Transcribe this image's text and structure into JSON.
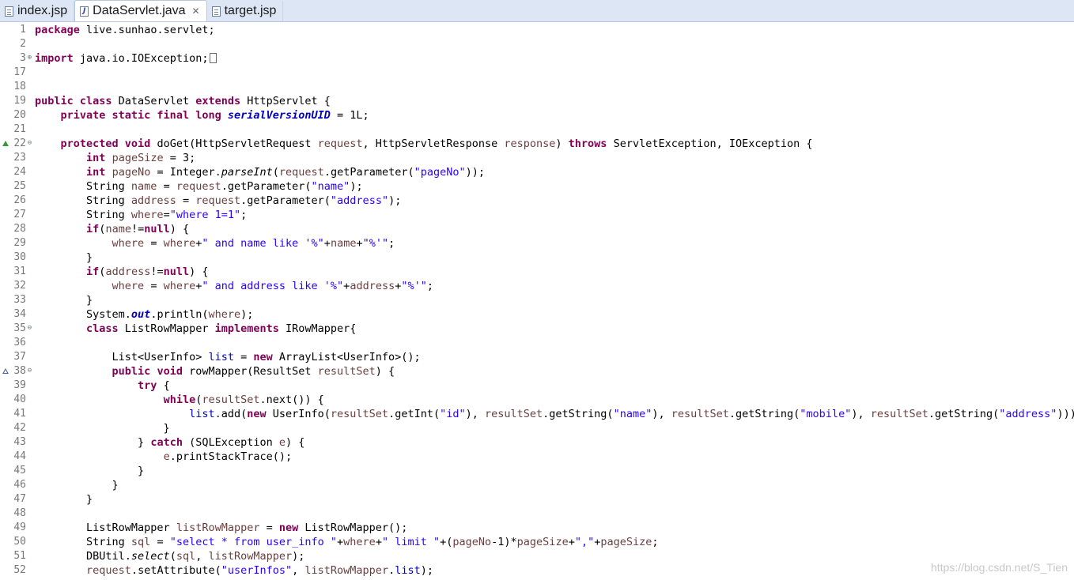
{
  "tabs": [
    {
      "label": "index.jsp",
      "icon": "jsp-file-icon",
      "active": false
    },
    {
      "label": "DataServlet.java",
      "icon": "java-file-icon",
      "active": true,
      "close": "✕"
    },
    {
      "label": "target.jsp",
      "icon": "jsp-file-icon",
      "active": false
    }
  ],
  "java_icon_glyph": "J",
  "lines": [
    {
      "n": "1",
      "tokens": [
        [
          "k",
          "package"
        ],
        [
          "",
          "live.sunhao.servlet;"
        ]
      ]
    },
    {
      "n": "2",
      "tokens": []
    },
    {
      "n": "3",
      "marker": "⊕",
      "fold_box": true,
      "tokens": [
        [
          "k",
          "import"
        ],
        [
          "",
          " java.io.IOException;"
        ]
      ]
    },
    {
      "n": "17",
      "tokens": []
    },
    {
      "n": "18",
      "tokens": []
    },
    {
      "n": "19",
      "tokens": [
        [
          "k",
          "public class"
        ],
        [
          "",
          " DataServlet "
        ],
        [
          "k",
          "extends"
        ],
        [
          "",
          " HttpServlet {"
        ]
      ]
    },
    {
      "n": "20",
      "tokens": [
        [
          "",
          "    "
        ],
        [
          "k",
          "private static final long"
        ],
        [
          "",
          " "
        ],
        [
          "sf",
          "serialVersionUID"
        ],
        [
          "",
          " = 1L;"
        ]
      ]
    },
    {
      "n": "21",
      "tokens": []
    },
    {
      "n": "22",
      "marker": "⊖",
      "override": "impl",
      "tokens": [
        [
          "",
          "    "
        ],
        [
          "k",
          "protected void"
        ],
        [
          "",
          " doGet(HttpServletRequest "
        ],
        [
          "v",
          "request"
        ],
        [
          "",
          ", HttpServletResponse "
        ],
        [
          "v",
          "response"
        ],
        [
          "",
          ") "
        ],
        [
          "k",
          "throws"
        ],
        [
          "",
          " ServletException, IOException {"
        ]
      ]
    },
    {
      "n": "23",
      "tokens": [
        [
          "",
          "        "
        ],
        [
          "k",
          "int"
        ],
        [
          "",
          " "
        ],
        [
          "v",
          "pageSize"
        ],
        [
          "",
          " = 3;"
        ]
      ]
    },
    {
      "n": "24",
      "tokens": [
        [
          "",
          "        "
        ],
        [
          "k",
          "int"
        ],
        [
          "",
          " "
        ],
        [
          "v",
          "pageNo"
        ],
        [
          "",
          " = Integer."
        ],
        [
          "it",
          "parseInt"
        ],
        [
          "",
          "("
        ],
        [
          "v",
          "request"
        ],
        [
          "",
          ".getParameter("
        ],
        [
          "s",
          "\"pageNo\""
        ],
        [
          "",
          "));"
        ]
      ]
    },
    {
      "n": "25",
      "tokens": [
        [
          "",
          "        String "
        ],
        [
          "v",
          "name"
        ],
        [
          "",
          " = "
        ],
        [
          "v",
          "request"
        ],
        [
          "",
          ".getParameter("
        ],
        [
          "s",
          "\"name\""
        ],
        [
          "",
          ");"
        ]
      ]
    },
    {
      "n": "26",
      "tokens": [
        [
          "",
          "        String "
        ],
        [
          "v",
          "address"
        ],
        [
          "",
          " = "
        ],
        [
          "v",
          "request"
        ],
        [
          "",
          ".getParameter("
        ],
        [
          "s",
          "\"address\""
        ],
        [
          "",
          ");"
        ]
      ]
    },
    {
      "n": "27",
      "tokens": [
        [
          "",
          "        String "
        ],
        [
          "v",
          "where"
        ],
        [
          "",
          "="
        ],
        [
          "s",
          "\"where 1=1\""
        ],
        [
          "",
          ";"
        ]
      ]
    },
    {
      "n": "28",
      "tokens": [
        [
          "",
          "        "
        ],
        [
          "k",
          "if"
        ],
        [
          "",
          "("
        ],
        [
          "v",
          "name"
        ],
        [
          "",
          "!="
        ],
        [
          "k",
          "null"
        ],
        [
          "",
          ") {"
        ]
      ]
    },
    {
      "n": "29",
      "tokens": [
        [
          "",
          "            "
        ],
        [
          "v",
          "where"
        ],
        [
          "",
          " = "
        ],
        [
          "v",
          "where"
        ],
        [
          "",
          "+"
        ],
        [
          "s",
          "\" and name like '%\""
        ],
        [
          "",
          "+"
        ],
        [
          "v",
          "name"
        ],
        [
          "",
          "+"
        ],
        [
          "s",
          "\"%'\""
        ],
        [
          "",
          ";"
        ]
      ]
    },
    {
      "n": "30",
      "tokens": [
        [
          "",
          "        }"
        ]
      ]
    },
    {
      "n": "31",
      "tokens": [
        [
          "",
          "        "
        ],
        [
          "k",
          "if"
        ],
        [
          "",
          "("
        ],
        [
          "v",
          "address"
        ],
        [
          "",
          "!="
        ],
        [
          "k",
          "null"
        ],
        [
          "",
          ") {"
        ]
      ]
    },
    {
      "n": "32",
      "tokens": [
        [
          "",
          "            "
        ],
        [
          "v",
          "where"
        ],
        [
          "",
          " = "
        ],
        [
          "v",
          "where"
        ],
        [
          "",
          "+"
        ],
        [
          "s",
          "\" and address like '%\""
        ],
        [
          "",
          "+"
        ],
        [
          "v",
          "address"
        ],
        [
          "",
          "+"
        ],
        [
          "s",
          "\"%'\""
        ],
        [
          "",
          ";"
        ]
      ]
    },
    {
      "n": "33",
      "tokens": [
        [
          "",
          "        }"
        ]
      ]
    },
    {
      "n": "34",
      "tokens": [
        [
          "",
          "        System."
        ],
        [
          "sf",
          "out"
        ],
        [
          "",
          ".println("
        ],
        [
          "v",
          "where"
        ],
        [
          "",
          ");"
        ]
      ]
    },
    {
      "n": "35",
      "marker": "⊖",
      "tokens": [
        [
          "",
          "        "
        ],
        [
          "k",
          "class"
        ],
        [
          "",
          " ListRowMapper "
        ],
        [
          "k",
          "implements"
        ],
        [
          "",
          " IRowMapper{"
        ]
      ]
    },
    {
      "n": "36",
      "tokens": []
    },
    {
      "n": "37",
      "tokens": [
        [
          "",
          "            List<UserInfo> "
        ],
        [
          "f",
          "list"
        ],
        [
          "",
          " = "
        ],
        [
          "k",
          "new"
        ],
        [
          "",
          " ArrayList<UserInfo>();"
        ]
      ]
    },
    {
      "n": "38",
      "marker": "⊖",
      "override": "sup",
      "tokens": [
        [
          "",
          "            "
        ],
        [
          "k",
          "public void"
        ],
        [
          "",
          " rowMapper(ResultSet "
        ],
        [
          "v",
          "resultSet"
        ],
        [
          "",
          ") {"
        ]
      ]
    },
    {
      "n": "39",
      "tokens": [
        [
          "",
          "                "
        ],
        [
          "k",
          "try"
        ],
        [
          "",
          " {"
        ]
      ]
    },
    {
      "n": "40",
      "tokens": [
        [
          "",
          "                    "
        ],
        [
          "k",
          "while"
        ],
        [
          "",
          "("
        ],
        [
          "v",
          "resultSet"
        ],
        [
          "",
          ".next()) {"
        ]
      ]
    },
    {
      "n": "41",
      "tokens": [
        [
          "",
          "                        "
        ],
        [
          "f",
          "list"
        ],
        [
          "",
          ".add("
        ],
        [
          "k",
          "new"
        ],
        [
          "",
          " UserInfo("
        ],
        [
          "v",
          "resultSet"
        ],
        [
          "",
          ".getInt("
        ],
        [
          "s",
          "\"id\""
        ],
        [
          "",
          "), "
        ],
        [
          "v",
          "resultSet"
        ],
        [
          "",
          ".getString("
        ],
        [
          "s",
          "\"name\""
        ],
        [
          "",
          "), "
        ],
        [
          "v",
          "resultSet"
        ],
        [
          "",
          ".getString("
        ],
        [
          "s",
          "\"mobile\""
        ],
        [
          "",
          "), "
        ],
        [
          "v",
          "resultSet"
        ],
        [
          "",
          ".getString("
        ],
        [
          "s",
          "\"address\""
        ],
        [
          "",
          ")));"
        ]
      ]
    },
    {
      "n": "42",
      "tokens": [
        [
          "",
          "                    }"
        ]
      ]
    },
    {
      "n": "43",
      "tokens": [
        [
          "",
          "                } "
        ],
        [
          "k",
          "catch"
        ],
        [
          "",
          " (SQLException "
        ],
        [
          "v",
          "e"
        ],
        [
          "",
          ") {"
        ]
      ]
    },
    {
      "n": "44",
      "tokens": [
        [
          "",
          "                    "
        ],
        [
          "v",
          "e"
        ],
        [
          "",
          ".printStackTrace();"
        ]
      ]
    },
    {
      "n": "45",
      "tokens": [
        [
          "",
          "                }"
        ]
      ]
    },
    {
      "n": "46",
      "tokens": [
        [
          "",
          "            }"
        ]
      ]
    },
    {
      "n": "47",
      "tokens": [
        [
          "",
          "        }"
        ]
      ]
    },
    {
      "n": "48",
      "tokens": []
    },
    {
      "n": "49",
      "tokens": [
        [
          "",
          "        ListRowMapper "
        ],
        [
          "v",
          "listRowMapper"
        ],
        [
          "",
          " = "
        ],
        [
          "k",
          "new"
        ],
        [
          "",
          " ListRowMapper();"
        ]
      ]
    },
    {
      "n": "50",
      "tokens": [
        [
          "",
          "        String "
        ],
        [
          "v",
          "sql"
        ],
        [
          "",
          " = "
        ],
        [
          "s",
          "\"select * from user_info \""
        ],
        [
          "",
          "+"
        ],
        [
          "v",
          "where"
        ],
        [
          "",
          "+"
        ],
        [
          "s",
          "\" limit \""
        ],
        [
          "",
          "+("
        ],
        [
          "v",
          "pageNo"
        ],
        [
          "",
          "-1)*"
        ],
        [
          "v",
          "pageSize"
        ],
        [
          "",
          "+"
        ],
        [
          "s",
          "\",\""
        ],
        [
          "",
          "+"
        ],
        [
          "v",
          "pageSize"
        ],
        [
          "",
          ";"
        ]
      ]
    },
    {
      "n": "51",
      "tokens": [
        [
          "",
          "        DBUtil."
        ],
        [
          "it",
          "select"
        ],
        [
          "",
          "("
        ],
        [
          "v",
          "sql"
        ],
        [
          "",
          ", "
        ],
        [
          "v",
          "listRowMapper"
        ],
        [
          "",
          ");"
        ]
      ]
    },
    {
      "n": "52",
      "tokens": [
        [
          "",
          "        "
        ],
        [
          "v",
          "request"
        ],
        [
          "",
          ".setAttribute("
        ],
        [
          "s",
          "\"userInfos\""
        ],
        [
          "",
          ", "
        ],
        [
          "v",
          "listRowMapper"
        ],
        [
          "",
          "."
        ],
        [
          "f",
          "list"
        ],
        [
          "",
          ");"
        ]
      ]
    }
  ],
  "watermark": "https://blog.csdn.net/S_Tien"
}
